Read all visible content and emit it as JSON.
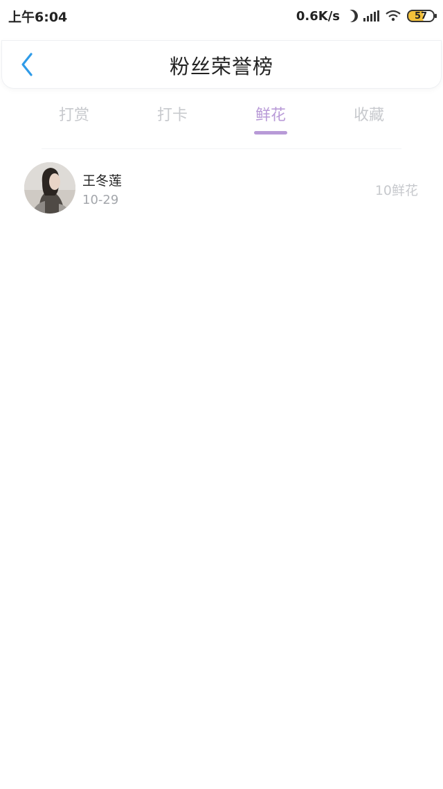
{
  "status_bar": {
    "time": "上午6:04",
    "net_speed": "0.6K/s",
    "battery_level": "57",
    "icons": [
      "moon-icon",
      "signal-icon",
      "wifi-icon",
      "battery-icon"
    ]
  },
  "header": {
    "title": "粉丝荣誉榜",
    "back_icon": "chevron-left-icon",
    "accent_color": "#2f9be8"
  },
  "tabs": [
    {
      "label": "打赏",
      "active": false
    },
    {
      "label": "打卡",
      "active": false
    },
    {
      "label": "鲜花",
      "active": true
    },
    {
      "label": "收藏",
      "active": false
    }
  ],
  "tab_active_color": "#b89ad7",
  "list": {
    "items": [
      {
        "name": "王冬莲",
        "date": "10-29",
        "count": "10鲜花",
        "avatar": "avatar-photo"
      }
    ]
  }
}
